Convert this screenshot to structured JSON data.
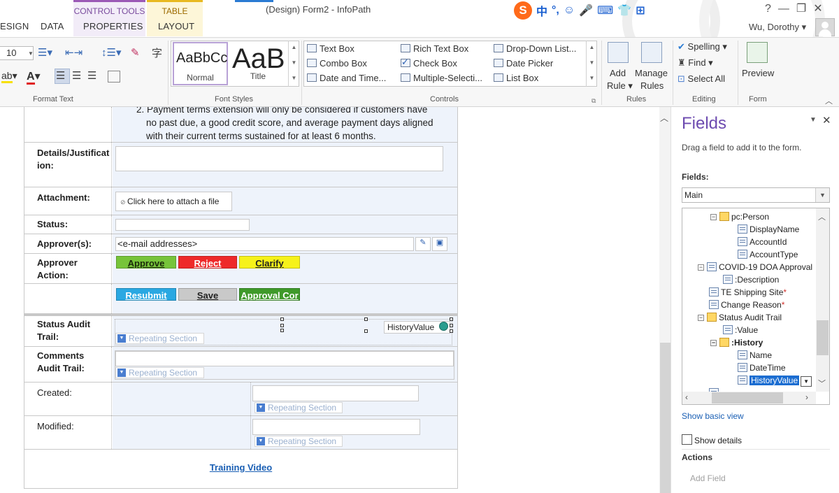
{
  "titlebar": {
    "ctx_control": "CONTROL TOOLS",
    "ctx_table": "TABLE TOOLS",
    "doc_title": "(Design) Form2 - InfoPath",
    "help": "?",
    "user": "Wu, Dorothy ▾"
  },
  "tabs": {
    "design": "ESIGN",
    "data": "DATA",
    "properties": "PROPERTIES",
    "layout": "LAYOUT"
  },
  "ime": [
    "中",
    "°,",
    "☺",
    "🎤",
    "⌨",
    "👕",
    "⊞"
  ],
  "ribbon": {
    "format_text": {
      "label": "Format Text",
      "font_size": "10"
    },
    "font_styles": {
      "label": "Font Styles",
      "normal_preview": "AaBbCc",
      "normal": "Normal",
      "title_preview": "AaB",
      "title": "Title"
    },
    "controls": {
      "label": "Controls",
      "items": [
        "Text Box",
        "Combo Box",
        "Date and Time...",
        "Rich Text Box",
        "Check Box",
        "Multiple-Selecti...",
        "Drop-Down List...",
        "Date Picker",
        "List Box"
      ]
    },
    "rules": {
      "label": "Rules",
      "add_rule_1": "Add",
      "add_rule_2": "Rule ▾",
      "manage_1": "Manage",
      "manage_2": "Rules"
    },
    "editing": {
      "label": "Editing",
      "spelling": "Spelling ▾",
      "find": "Find ▾",
      "select_all": "Select All"
    },
    "form": {
      "label": "Form",
      "preview": "Preview"
    }
  },
  "form": {
    "payment_text": "2.  Payment terms extension will only be considered if customers have no past due, a good credit score, and average payment days aligned with their current terms sustained for at least 6 months.",
    "details_label": "Details/Justification:",
    "attachment_label": "Attachment:",
    "attach_placeholder": "Click here to attach a file",
    "status_label": "Status:",
    "approvers_label": "Approver(s):",
    "approvers_value": "<e-mail addresses>",
    "approver_action_label": "Approver Action:",
    "btn_approve": "Approve",
    "btn_reject": "Reject",
    "btn_clarify": "Clarify",
    "btn_resubmit": "Resubmit",
    "btn_save": "Save",
    "btn_approval_cor": "Approval Cor",
    "status_audit_label": "Status Audit Trail:",
    "history_value": "HistoryValue",
    "repeating_section": "Repeating Section",
    "comments_audit_label": "Comments Audit Trail:",
    "created_label": "Created:",
    "modified_label": "Modified:",
    "training_video": "Training Video"
  },
  "pane": {
    "title": "Fields",
    "subtitle": "Drag a field to add it to the form.",
    "fields_label": "Fields:",
    "datasource": "Main",
    "tree": [
      "pc:Person",
      "DisplayName",
      "AccountId",
      "AccountType",
      "COVID-19 DOA Approval",
      ":Description",
      "TE Shipping Site",
      "Change Reason",
      "Status Audit Trail",
      ":Value",
      ":History",
      "Name",
      "DateTime",
      "HistoryValue"
    ],
    "show_basic": "Show basic view",
    "show_details": "Show details",
    "actions": "Actions",
    "add_field": "Add Field"
  }
}
